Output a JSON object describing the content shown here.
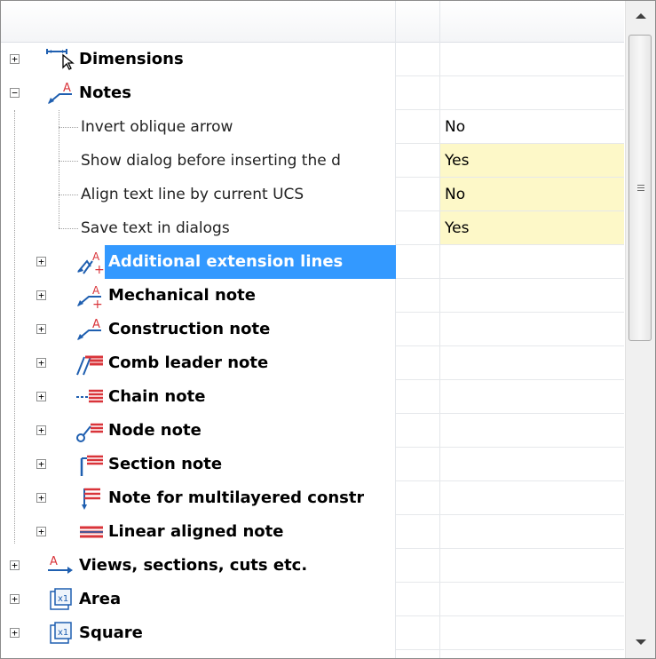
{
  "tree": {
    "items": [
      {
        "label": "Dimensions",
        "expander": "+",
        "icon": "dimensions-icon",
        "level": 0
      },
      {
        "label": "Notes",
        "expander": "−",
        "icon": "notes-icon",
        "level": 0
      },
      {
        "label": "Invert oblique arrow",
        "value": "No",
        "level": 2,
        "yellow": false
      },
      {
        "label": "Show dialog before inserting the d",
        "value": "Yes",
        "level": 2,
        "yellow": true
      },
      {
        "label": "Align text line by current UCS",
        "value": "No",
        "level": 2,
        "yellow": true
      },
      {
        "label": "Save text in dialogs",
        "value": "Yes",
        "level": 2,
        "yellow": true
      },
      {
        "label": "Additional extension lines",
        "expander": "+",
        "icon": "extension-lines-icon",
        "level": 1,
        "selected": true
      },
      {
        "label": "Mechanical note",
        "expander": "+",
        "icon": "mechanical-note-icon",
        "level": 1
      },
      {
        "label": "Construction note",
        "expander": "+",
        "icon": "construction-note-icon",
        "level": 1
      },
      {
        "label": "Comb leader note",
        "expander": "+",
        "icon": "comb-leader-icon",
        "level": 1
      },
      {
        "label": "Chain note",
        "expander": "+",
        "icon": "chain-note-icon",
        "level": 1
      },
      {
        "label": "Node note",
        "expander": "+",
        "icon": "node-note-icon",
        "level": 1
      },
      {
        "label": "Section note",
        "expander": "+",
        "icon": "section-note-icon",
        "level": 1
      },
      {
        "label": "Note for multilayered constr",
        "expander": "+",
        "icon": "multilayer-note-icon",
        "level": 1
      },
      {
        "label": "Linear aligned note",
        "expander": "+",
        "icon": "linear-aligned-note-icon",
        "level": 1
      },
      {
        "label": "Views, sections, cuts etc.",
        "expander": "+",
        "icon": "views-icon",
        "level": 0
      },
      {
        "label": "Area",
        "expander": "+",
        "icon": "area-icon",
        "level": 0
      },
      {
        "label": "Square",
        "expander": "+",
        "icon": "square-icon",
        "level": 0
      }
    ]
  },
  "colors": {
    "selection": "#3399ff",
    "highlight_value": "#fdf8c8",
    "icon_blue": "#1f5fb0",
    "icon_red": "#d9343a"
  }
}
